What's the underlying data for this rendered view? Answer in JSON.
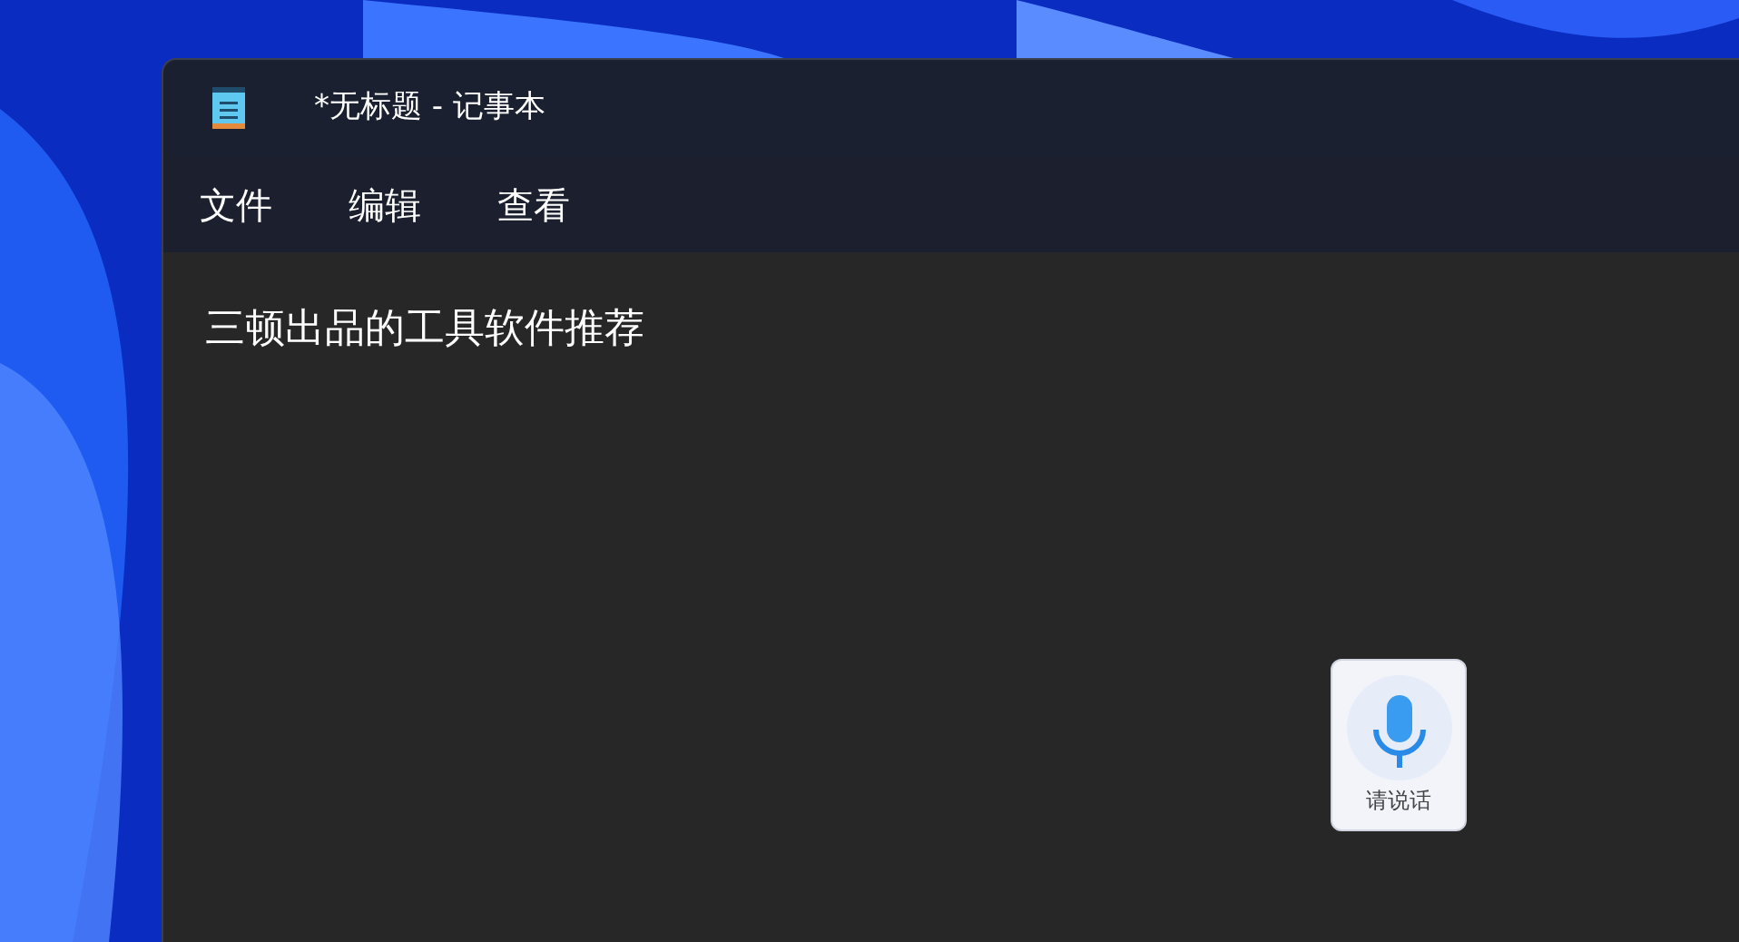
{
  "window": {
    "title": "*无标题 - 记事本"
  },
  "menu": [
    "文件",
    "编辑",
    "查看"
  ],
  "editor": {
    "value": "三顿出品的工具软件推荐"
  },
  "voice_widget": {
    "label": "请说话"
  }
}
